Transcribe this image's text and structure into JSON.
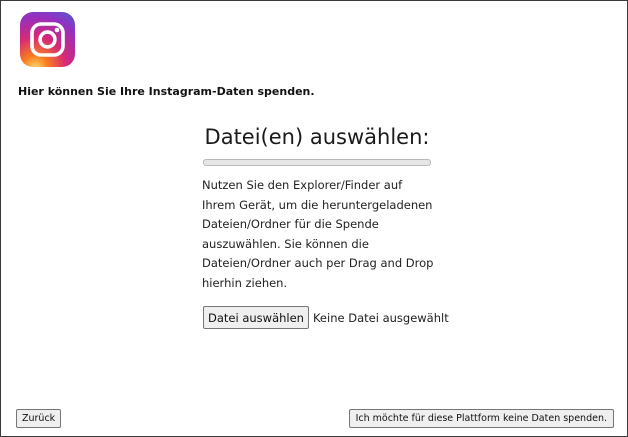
{
  "app": {
    "logo_icon": "instagram-logo",
    "logo_colors": [
      "#feda75",
      "#fa7e1e",
      "#d62976",
      "#962fbf",
      "#4f5bd5"
    ]
  },
  "intro_text": "Hier können Sie Ihre Instagram-Daten spenden.",
  "upload": {
    "title": "Datei(en) auswählen:",
    "progress": 0,
    "instructions": "Nutzen Sie den Explorer/Finder auf Ihrem Gerät, um die heruntergeladenen Dateien/Ordner für die Spende auszuwählen. Sie können die Dateien/Ordner auch per Drag and Drop hierhin ziehen.",
    "file_button_label": "Datei auswählen",
    "file_status": "Keine Datei ausgewählt"
  },
  "footer": {
    "back_label": "Zurück",
    "decline_label": "Ich möchte für diese Plattform keine Daten spenden."
  }
}
